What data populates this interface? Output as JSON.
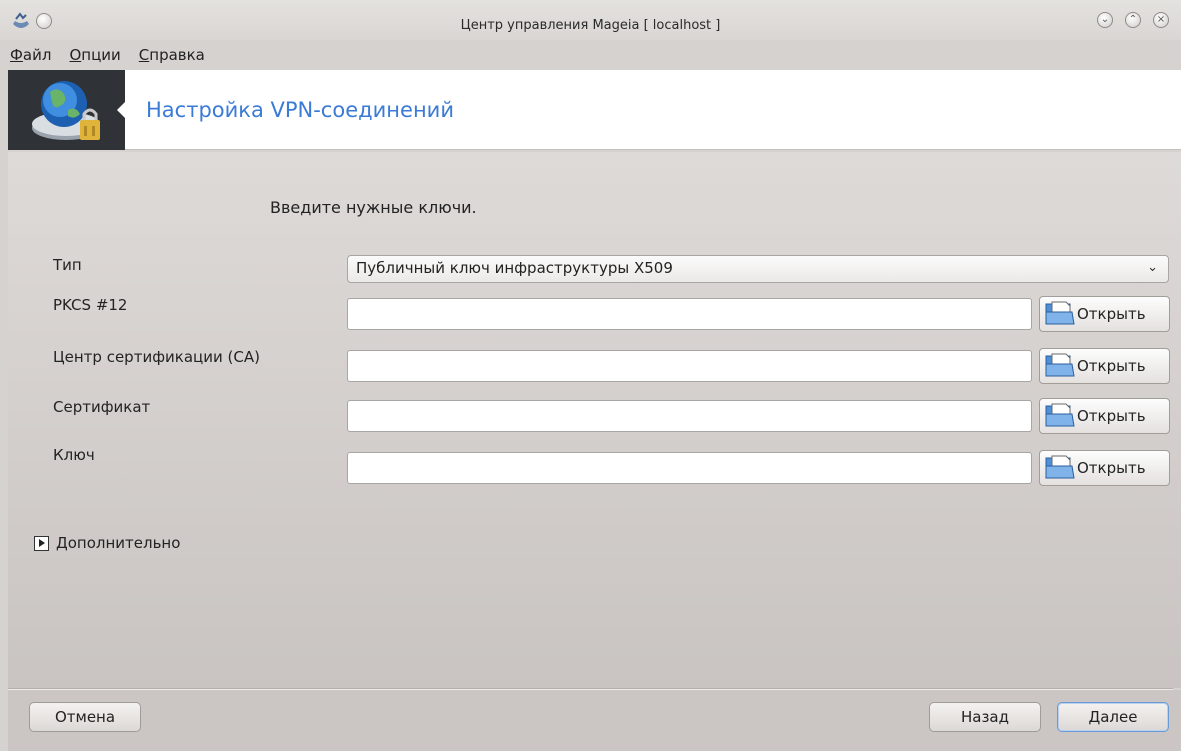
{
  "window": {
    "title": "Центр управления Mageia  [ localhost ]"
  },
  "menubar": {
    "items": [
      {
        "accel": "Ф",
        "rest": "айл"
      },
      {
        "accel": "О",
        "rest": "пции"
      },
      {
        "accel": "С",
        "rest": "правка"
      }
    ]
  },
  "banner": {
    "title": "Настройка VPN-соединений",
    "icon": "network-lock-icon"
  },
  "form": {
    "instruction": "Введите нужные ключи.",
    "type_label": "Тип",
    "type_value": "Публичный ключ инфраструктуры X509",
    "fields": [
      {
        "label": "PKCS #12",
        "value": "",
        "button": "Открыть"
      },
      {
        "label": "Центр сертификации (CA)",
        "value": "",
        "button": "Открыть"
      },
      {
        "label": "Сертификат",
        "value": "",
        "button": "Открыть"
      },
      {
        "label": "Ключ",
        "value": "",
        "button": "Открыть"
      }
    ],
    "advanced_label": "Дополнительно"
  },
  "footer": {
    "cancel": "Отмена",
    "back": "Назад",
    "next": "Далее"
  },
  "colors": {
    "banner_title": "#3a7bd5",
    "banner_icon_bg": "#2f3337",
    "background": "#d6d2d0"
  }
}
